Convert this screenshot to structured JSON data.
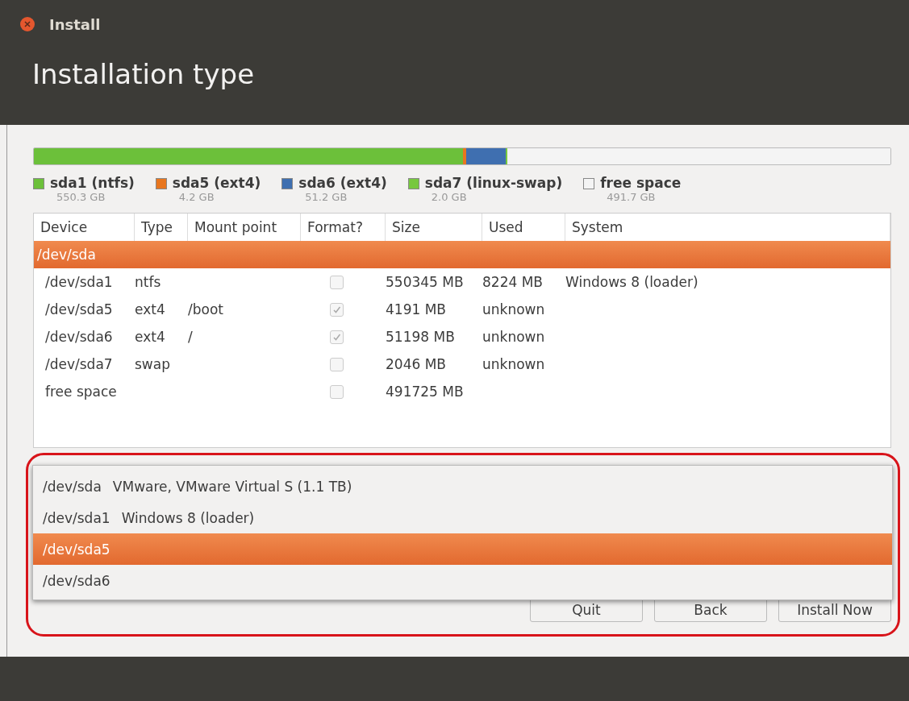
{
  "window": {
    "title": "Install"
  },
  "header": {
    "title": "Installation type"
  },
  "partitions": [
    {
      "name": "sda1 (ntfs)",
      "size": "550.3 GB",
      "color": "#6cc03a"
    },
    {
      "name": "sda5 (ext4)",
      "size": "4.2 GB",
      "color": "#e8761f"
    },
    {
      "name": "sda6 (ext4)",
      "size": "51.2 GB",
      "color": "#3f6fb0"
    },
    {
      "name": "sda7 (linux-swap)",
      "size": "2.0 GB",
      "color": "#77c83f"
    },
    {
      "name": "free space",
      "size": "491.7 GB",
      "color": "#f4f4f4"
    }
  ],
  "table": {
    "columns": [
      "Device",
      "Type",
      "Mount point",
      "Format?",
      "Size",
      "Used",
      "System"
    ],
    "rows": [
      {
        "device": "/dev/sda",
        "selected": true
      },
      {
        "device": "/dev/sda1",
        "type": "ntfs",
        "format": false,
        "size": "550345 MB",
        "used": "8224 MB",
        "system": "Windows 8 (loader)",
        "selected": false
      },
      {
        "device": "/dev/sda5",
        "type": "ext4",
        "mount": "/boot",
        "format": true,
        "size": "4191 MB",
        "used": "unknown",
        "selected": false
      },
      {
        "device": "/dev/sda6",
        "type": "ext4",
        "mount": "/",
        "format": true,
        "size": "51198 MB",
        "used": "unknown",
        "selected": false
      },
      {
        "device": "/dev/sda7",
        "type": "swap",
        "format": false,
        "size": "2046 MB",
        "used": "unknown",
        "selected": false
      },
      {
        "device": "free space",
        "format": false,
        "size": "491725 MB",
        "selected": false
      }
    ]
  },
  "bootloader_menu": {
    "items": [
      {
        "device": "/dev/sda",
        "description": "VMware, VMware Virtual S (1.1 TB)",
        "selected": false
      },
      {
        "device": "/dev/sda1",
        "description": "Windows 8 (loader)",
        "selected": false
      },
      {
        "device": "/dev/sda5",
        "selected": true
      },
      {
        "device": "/dev/sda6",
        "selected": false
      }
    ]
  },
  "buttons": [
    "Quit",
    "Back",
    "Install Now"
  ]
}
